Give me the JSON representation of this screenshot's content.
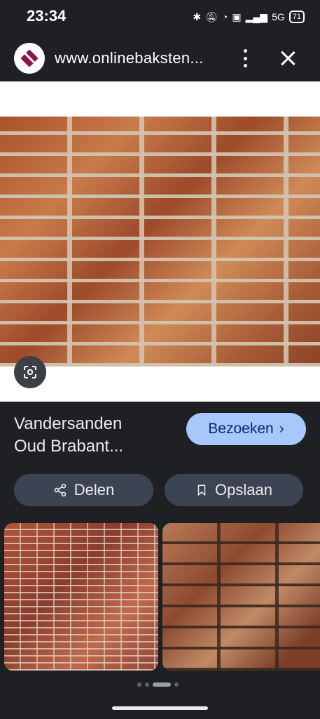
{
  "status_bar": {
    "time": "23:34",
    "icons": [
      "bluetooth-icon",
      "mute-icon",
      "wifi-icon",
      "volte-icon",
      "signal-icon"
    ],
    "network": "5G",
    "battery": "71"
  },
  "url_bar": {
    "url": "www.onlinebaksten..."
  },
  "result": {
    "title_line1": "Vandersanden",
    "title_line2": "Oud Brabant...",
    "visit_label": "Bezoeken",
    "visit_chevron": "›",
    "share_label": "Delen",
    "save_label": "Opslaan"
  },
  "colors": {
    "background": "#1f2024",
    "visit_button": "#a8c7fa",
    "pill_button": "#3c4453",
    "logo": "#8e1548"
  }
}
